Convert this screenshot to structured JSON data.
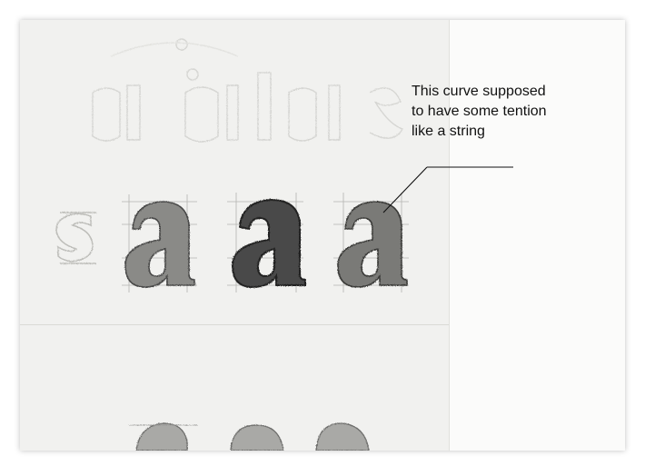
{
  "annotation": {
    "lines": [
      "This curve supposed",
      "to have some tention",
      "like a string"
    ]
  }
}
